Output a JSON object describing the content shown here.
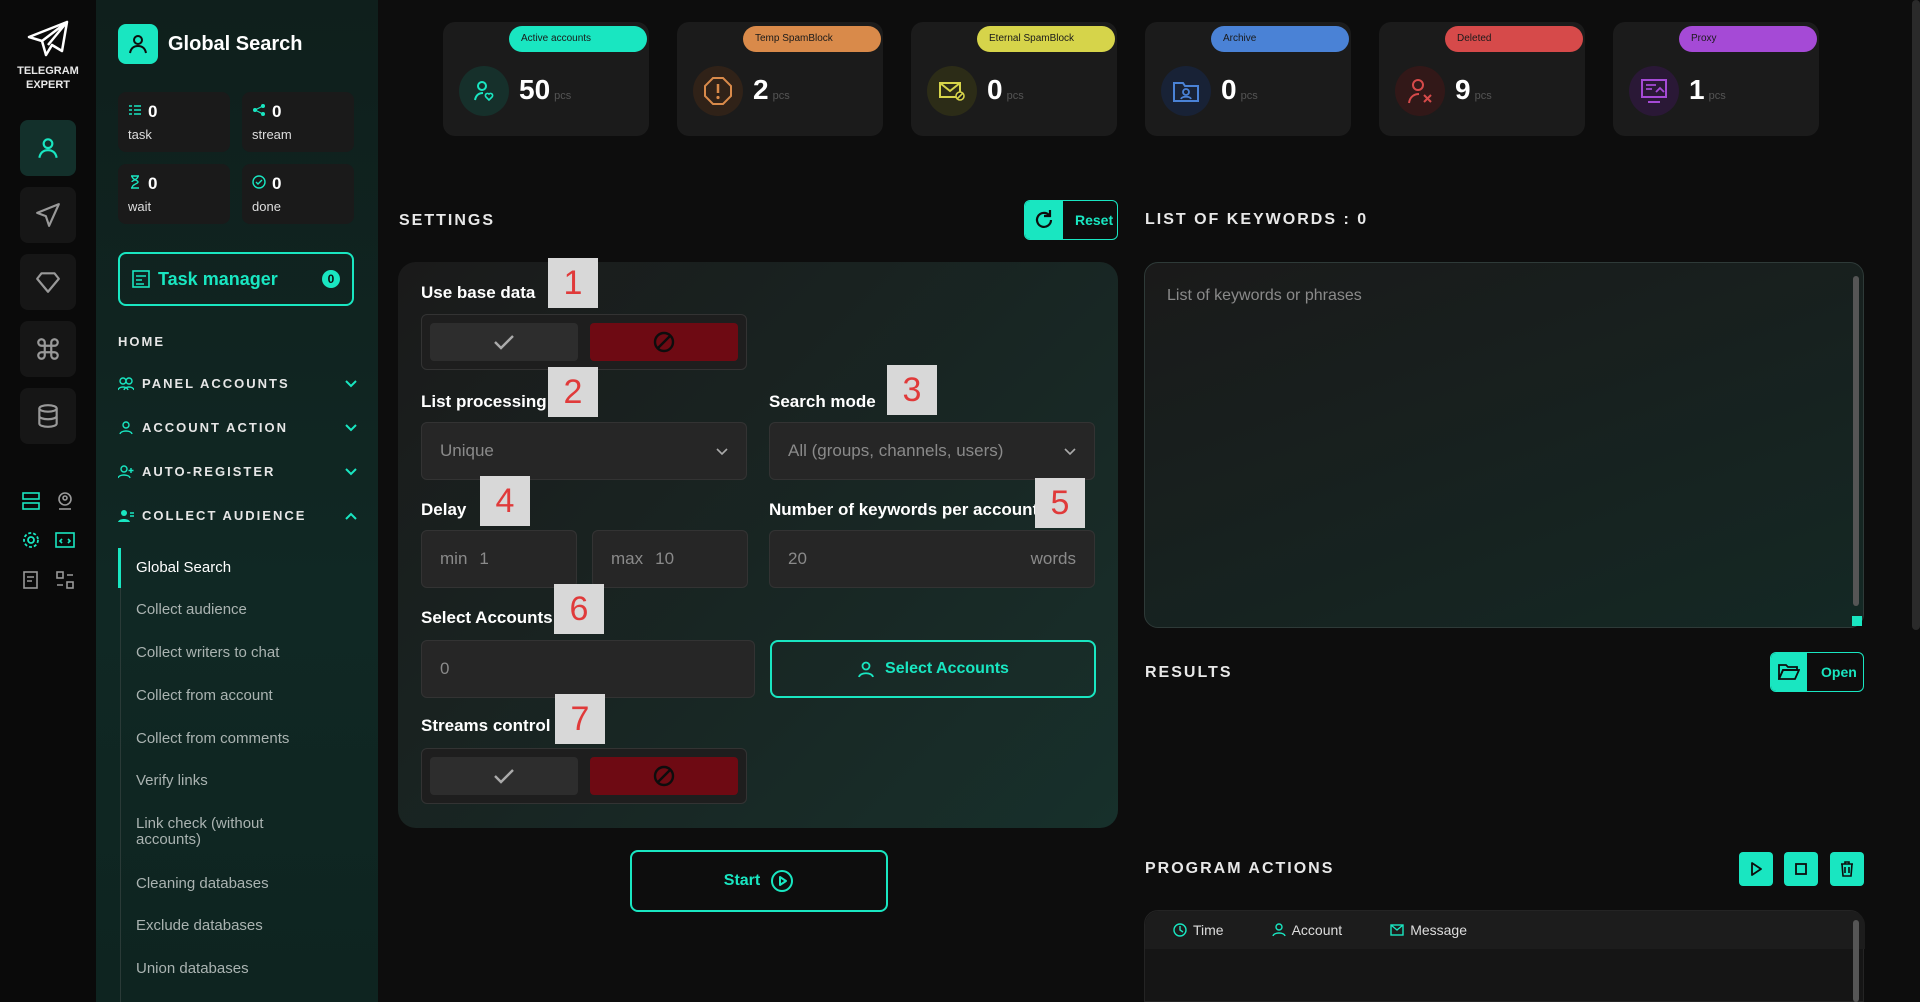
{
  "app": {
    "logo_line1": "TELEGRAM",
    "logo_line2": "EXPERT",
    "title": "Global Search"
  },
  "colors": {
    "accent": "#19e6c1",
    "deny": "#6e0a13"
  },
  "stats": [
    {
      "value": "0",
      "label": "task",
      "icon": "tasks-icon"
    },
    {
      "value": "0",
      "label": "stream",
      "icon": "stream-icon"
    },
    {
      "value": "0",
      "label": "wait",
      "icon": "hourglass-icon"
    },
    {
      "value": "0",
      "label": "done",
      "icon": "check-circle-icon"
    }
  ],
  "task_manager": {
    "label": "Task manager",
    "count": "0"
  },
  "nav": {
    "home": "HOME",
    "panel_accounts": "PANEL ACCOUNTS",
    "account_action": "ACCOUNT ACTION",
    "auto_register": "AUTO-REGISTER",
    "collect_audience": "COLLECT AUDIENCE",
    "sub": [
      "Global Search",
      "Collect audience",
      "Collect writers to chat",
      "Collect from account",
      "Collect from comments",
      "Verify links",
      "Link check (without accounts)",
      "Cleaning databases",
      "Exclude databases",
      "Union databases"
    ]
  },
  "cards": [
    {
      "badge": "Active accounts",
      "value": "50",
      "unit": "pcs",
      "color": "#19e6c1",
      "icon": "user-heart-icon"
    },
    {
      "badge": "Temp SpamBlock",
      "value": "2",
      "unit": "pcs",
      "color": "#d98a4a",
      "icon": "warning-icon"
    },
    {
      "badge": "Eternal SpamBlock",
      "value": "0",
      "unit": "pcs",
      "color": "#d6d44a",
      "icon": "mail-block-icon"
    },
    {
      "badge": "Archive",
      "value": "0",
      "unit": "pcs",
      "color": "#4a82d6",
      "icon": "archive-icon"
    },
    {
      "badge": "Deleted",
      "value": "9",
      "unit": "pcs",
      "color": "#d64a4a",
      "icon": "user-x-icon"
    },
    {
      "badge": "Proxy",
      "value": "1",
      "unit": "pcs",
      "color": "#a54ad6",
      "icon": "proxy-icon"
    }
  ],
  "settings": {
    "title": "SETTINGS",
    "reset": "Reset",
    "use_base_data": "Use base data",
    "list_processing": "List processing",
    "list_processing_value": "Unique",
    "search_mode": "Search mode",
    "search_mode_value": "All (groups, channels, users)",
    "delay": "Delay",
    "delay_min_prefix": "min",
    "delay_min": "1",
    "delay_max_prefix": "max",
    "delay_max": "10",
    "keywords_per_account": "Number of keywords per account",
    "keywords_per_account_value": "20",
    "keywords_per_account_unit": "words",
    "select_accounts": "Select Accounts",
    "select_accounts_value": "0",
    "select_accounts_button": "Select Accounts",
    "streams_control": "Streams control",
    "start": "Start"
  },
  "markers": [
    "1",
    "2",
    "3",
    "4",
    "5",
    "6",
    "7"
  ],
  "keywords": {
    "title": "LIST OF KEYWORDS : 0",
    "placeholder": "List of keywords or phrases"
  },
  "results": {
    "title": "RESULTS",
    "open": "Open"
  },
  "program_actions": {
    "title": "PROGRAM ACTIONS",
    "columns": [
      "Time",
      "Account",
      "Message"
    ]
  }
}
